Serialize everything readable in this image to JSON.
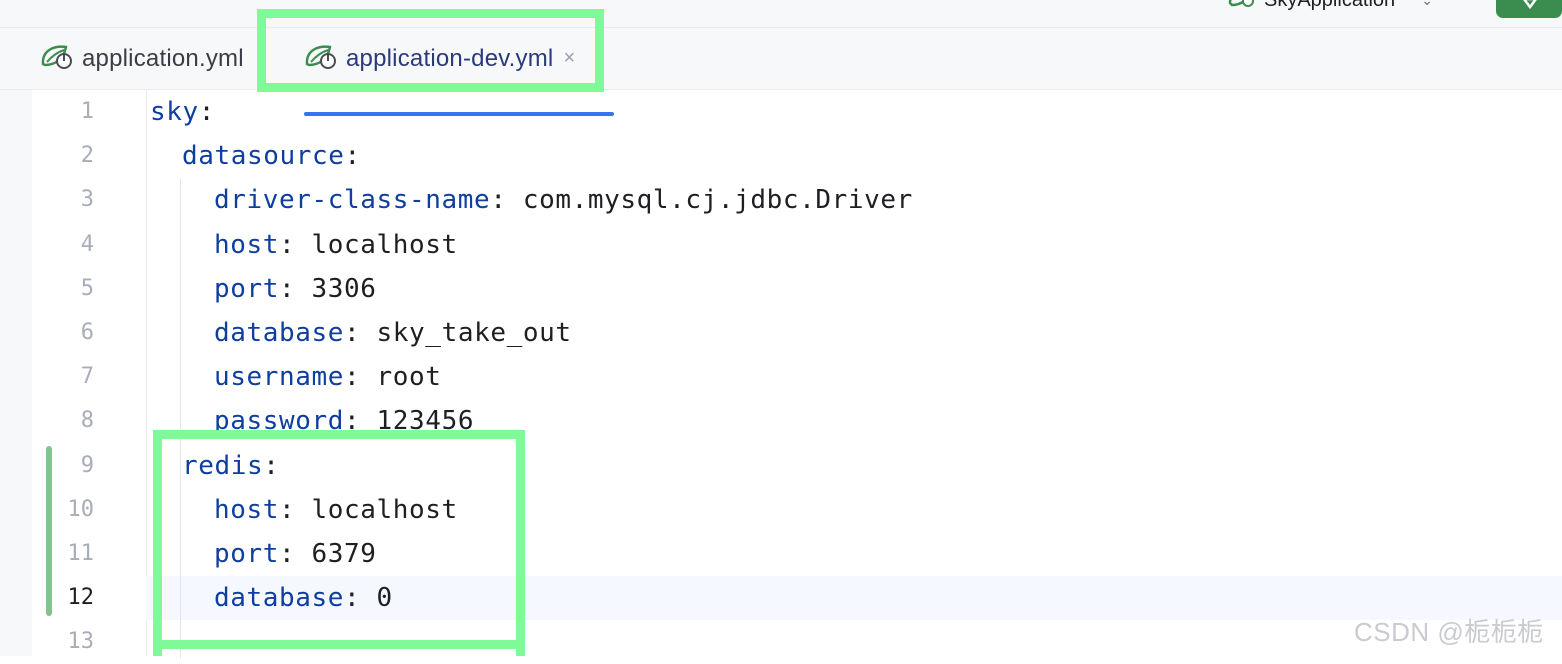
{
  "run_bar": {
    "config_name": "SkyApplication",
    "config_icon": "spring-boot-icon",
    "run_icon": "run-icon"
  },
  "tabs": [
    {
      "label": "application.yml",
      "icon": "spring-config-icon",
      "active": false
    },
    {
      "label": "application-dev.yml",
      "icon": "spring-config-icon",
      "active": true,
      "close": "×"
    }
  ],
  "editor": {
    "current_line": 12,
    "line_numbers": [
      "1",
      "2",
      "3",
      "4",
      "5",
      "6",
      "7",
      "8",
      "9",
      "10",
      "11",
      "12",
      "13"
    ],
    "lines": [
      {
        "key": "sky",
        "colon": ":",
        "value": ""
      },
      {
        "key": "datasource",
        "colon": ":",
        "value": ""
      },
      {
        "key": "driver-class-name",
        "colon": ":",
        "value": " com.mysql.cj.jdbc.Driver"
      },
      {
        "key": "host",
        "colon": ":",
        "value": " localhost"
      },
      {
        "key": "port",
        "colon": ":",
        "value": " 3306"
      },
      {
        "key": "database",
        "colon": ":",
        "value": " sky_take_out"
      },
      {
        "key": "username",
        "colon": ":",
        "value": " root"
      },
      {
        "key": "password",
        "colon": ":",
        "value": " 123456"
      },
      {
        "key": "redis",
        "colon": ":",
        "value": ""
      },
      {
        "key": "host",
        "colon": ":",
        "value": " localhost"
      },
      {
        "key": "port",
        "colon": ":",
        "value": " 6379"
      },
      {
        "key": "database",
        "colon": ":",
        "value": " 0"
      },
      {
        "key": "",
        "colon": "",
        "value": ""
      }
    ]
  },
  "colors": {
    "highlight": "#80fa98",
    "key": "#0f3ea1",
    "accent": "#3574f0",
    "change_marker": "#82c38f"
  },
  "watermark": "CSDN @栀栀栀"
}
